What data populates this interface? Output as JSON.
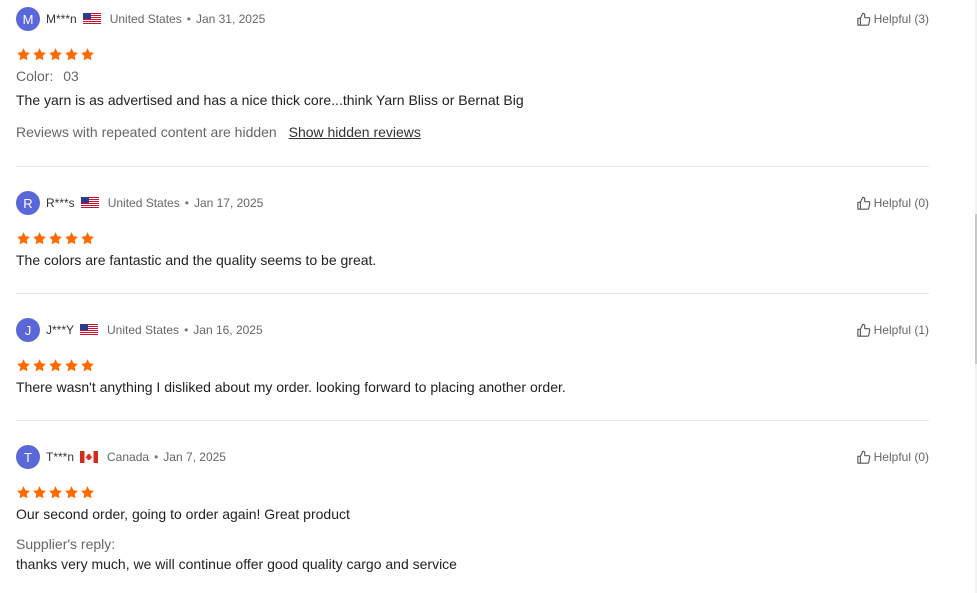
{
  "reviews": [
    {
      "avatar_letter": "M",
      "name": "M***n",
      "country": "United States",
      "date": "Jan 31, 2025",
      "helpful": "Helpful (3)",
      "rating": 5,
      "color_label": "Color:",
      "color_value": "03",
      "text": "The yarn is as advertised and has a nice thick core...think Yarn Bliss or Bernat Big",
      "hidden_note": "Reviews with repeated content are hidden",
      "hidden_link": "Show hidden reviews"
    },
    {
      "avatar_letter": "R",
      "name": "R***s",
      "country": "United States",
      "date": "Jan 17, 2025",
      "helpful": "Helpful (0)",
      "rating": 5,
      "text": "The colors are fantastic and the quality seems to be great."
    },
    {
      "avatar_letter": "J",
      "name": "J***Y",
      "country": "United States",
      "date": "Jan 16, 2025",
      "helpful": "Helpful (1)",
      "rating": 5,
      "text": "There wasn't anything I disliked about my order. looking forward to placing another order."
    },
    {
      "avatar_letter": "T",
      "name": "T***n",
      "country": "Canada",
      "date": "Jan 7, 2025",
      "helpful": "Helpful (0)",
      "rating": 5,
      "text": "Our second order, going to order again! Great product",
      "reply_label": "Supplier's reply:",
      "reply_text": "thanks very much, we will continue offer good quality cargo and service"
    }
  ],
  "separator": "•",
  "colors": {
    "star": "#ff6a00",
    "avatar": "#5a67d8"
  }
}
